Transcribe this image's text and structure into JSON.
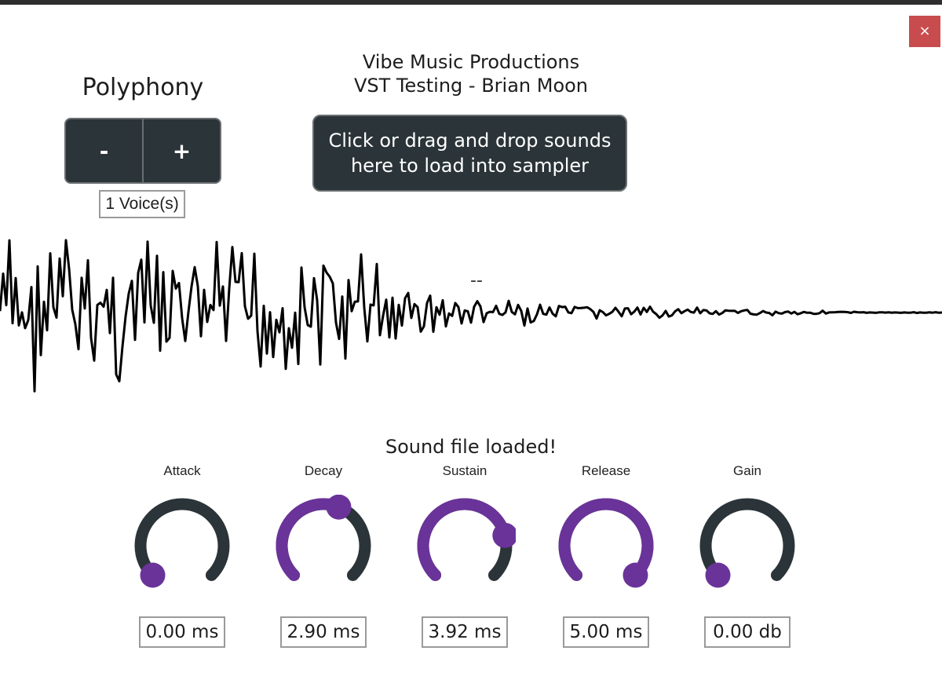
{
  "window": {
    "close_label": "×"
  },
  "header": {
    "line1": "Vibe Music Productions",
    "line2": "VST Testing - Brian Moon"
  },
  "polyphony": {
    "title": "Polyphony",
    "minus_label": "-",
    "plus_label": "+",
    "voices": "1 Voice(s)"
  },
  "drop_zone": {
    "label": "Click or drag and drop sounds here to load into sampler"
  },
  "waveform": {
    "marker": "--"
  },
  "status": "Sound file loaded!",
  "colors": {
    "accent": "#6a3399",
    "track": "#2b3438",
    "close": "#c84c4e"
  },
  "knobs": [
    {
      "label": "Attack",
      "value": "0.00 ms",
      "level": 0.0
    },
    {
      "label": "Decay",
      "value": "2.90 ms",
      "level": 0.58
    },
    {
      "label": "Sustain",
      "value": "3.92 ms",
      "level": 0.78
    },
    {
      "label": "Release",
      "value": "5.00 ms",
      "level": 1.0
    },
    {
      "label": "Gain",
      "value": "0.00 db",
      "level": 0.0
    }
  ]
}
